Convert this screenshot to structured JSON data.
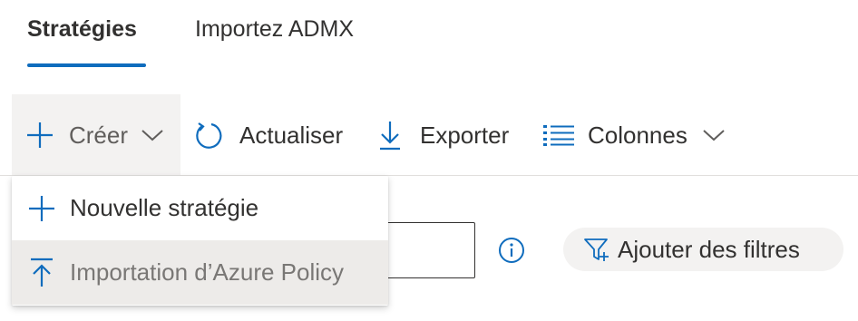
{
  "tabs": {
    "policies": "Stratégies",
    "import_admx": "Importez ADMX"
  },
  "toolbar": {
    "create_label": "Créer",
    "refresh_label": "Actualiser",
    "export_label": "Exporter",
    "columns_label": "Colonnes"
  },
  "create_menu": {
    "new_policy": "Nouvelle stratégie",
    "import_azure_policy": "Importation d’Azure Policy"
  },
  "filters": {
    "add_filters_label": "Ajouter des filtres"
  },
  "search": {
    "value": ""
  },
  "colors": {
    "accent": "#0f6cbd",
    "text": "#323130",
    "menu_hover": "#edebe9",
    "button_bg": "#f3f2f1"
  },
  "icons": {
    "create": "add-icon",
    "create_chevron": "chevron-down-icon",
    "refresh": "refresh-icon",
    "export": "download-icon",
    "columns": "list-icon",
    "columns_chevron": "chevron-down-icon",
    "new_policy": "add-icon",
    "import": "upload-icon",
    "info": "info-icon",
    "filter": "filter-add-icon"
  }
}
